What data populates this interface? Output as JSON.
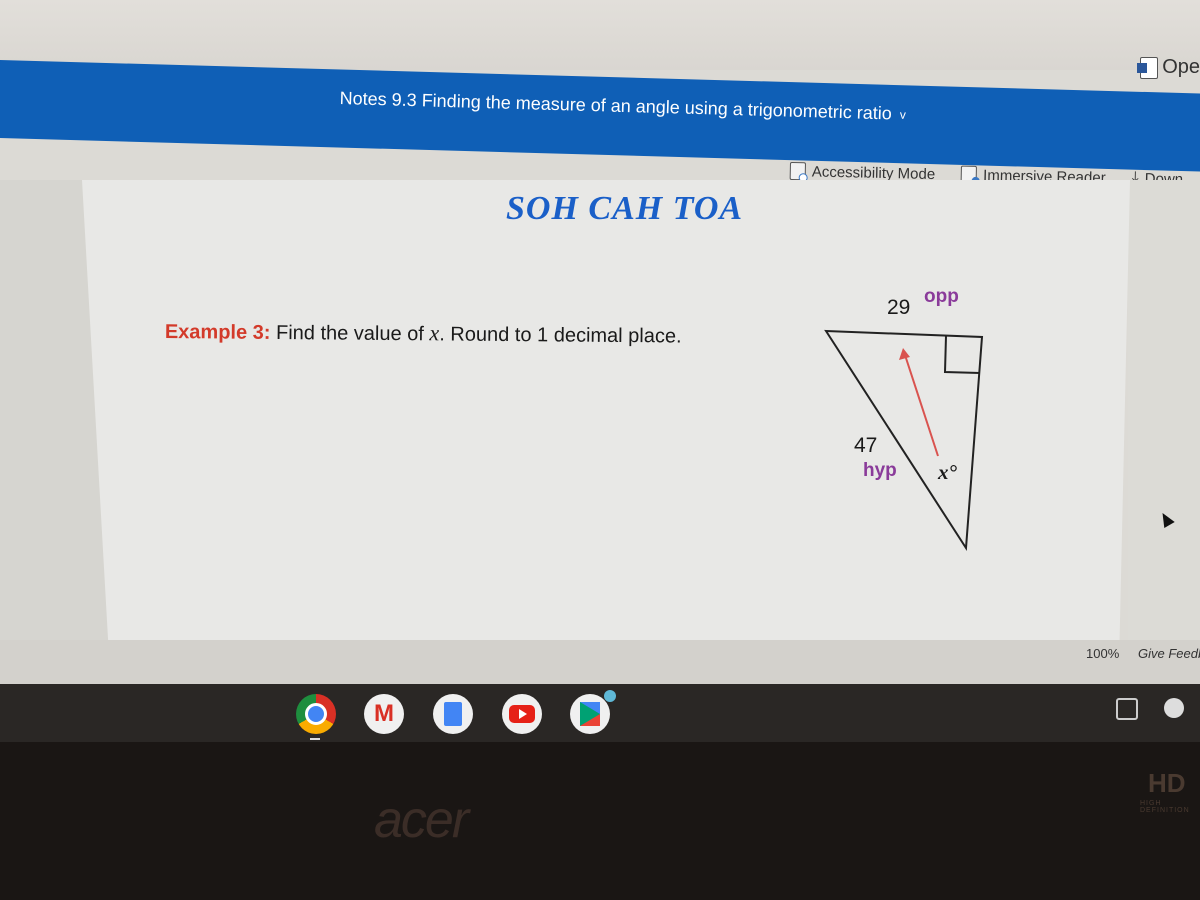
{
  "window": {
    "open_button_label": "Ope",
    "title": "Notes 9.3 Finding the measure of an angle using a trigonometric ratio",
    "title_chevron": "v"
  },
  "toolbar": {
    "items": [
      {
        "label": "Accessibility Mode",
        "icon": "accessibility-icon"
      },
      {
        "label": "Immersive Reader",
        "icon": "immersive-reader-icon"
      },
      {
        "label": "Down",
        "icon": "download-icon"
      }
    ]
  },
  "document": {
    "mnemonic": "SOH CAH TOA",
    "example_label": "Example 3:",
    "example_text_pre": "Find the value of",
    "example_var": "x",
    "example_text_post": ".  Round to 1 decimal place.",
    "diagram": {
      "opposite_value": "29",
      "opposite_tag": "opp",
      "hypotenuse_value": "47",
      "hypotenuse_tag": "hyp",
      "angle_label": "x°",
      "colors": {
        "tag": "#8a3b9a",
        "arrow": "#d9534f",
        "mnemonic": "#1a5fc8",
        "example_label": "#d33a2a"
      }
    }
  },
  "statusbar": {
    "zoom": "100%",
    "feedback": "Give Feedb"
  },
  "shelf": {
    "apps": [
      "chrome",
      "gmail",
      "docs",
      "youtube",
      "play-store"
    ]
  },
  "bezel": {
    "brand": "acer",
    "hd_badge": "HD",
    "hd_sub": "HIGH DEFINITION"
  },
  "accent_color": "#0f5fb6"
}
